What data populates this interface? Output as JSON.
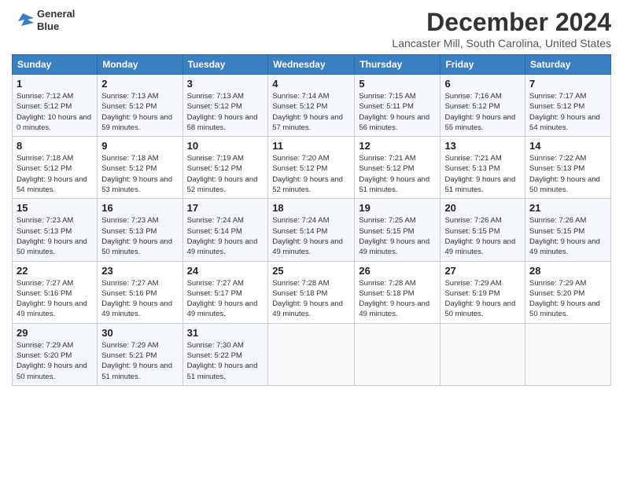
{
  "header": {
    "logo_line1": "General",
    "logo_line2": "Blue",
    "month": "December 2024",
    "location": "Lancaster Mill, South Carolina, United States"
  },
  "days_of_week": [
    "Sunday",
    "Monday",
    "Tuesday",
    "Wednesday",
    "Thursday",
    "Friday",
    "Saturday"
  ],
  "weeks": [
    [
      {
        "day": "1",
        "sunrise": "Sunrise: 7:12 AM",
        "sunset": "Sunset: 5:12 PM",
        "daylight": "Daylight: 10 hours and 0 minutes."
      },
      {
        "day": "2",
        "sunrise": "Sunrise: 7:13 AM",
        "sunset": "Sunset: 5:12 PM",
        "daylight": "Daylight: 9 hours and 59 minutes."
      },
      {
        "day": "3",
        "sunrise": "Sunrise: 7:13 AM",
        "sunset": "Sunset: 5:12 PM",
        "daylight": "Daylight: 9 hours and 58 minutes."
      },
      {
        "day": "4",
        "sunrise": "Sunrise: 7:14 AM",
        "sunset": "Sunset: 5:12 PM",
        "daylight": "Daylight: 9 hours and 57 minutes."
      },
      {
        "day": "5",
        "sunrise": "Sunrise: 7:15 AM",
        "sunset": "Sunset: 5:11 PM",
        "daylight": "Daylight: 9 hours and 56 minutes."
      },
      {
        "day": "6",
        "sunrise": "Sunrise: 7:16 AM",
        "sunset": "Sunset: 5:12 PM",
        "daylight": "Daylight: 9 hours and 55 minutes."
      },
      {
        "day": "7",
        "sunrise": "Sunrise: 7:17 AM",
        "sunset": "Sunset: 5:12 PM",
        "daylight": "Daylight: 9 hours and 54 minutes."
      }
    ],
    [
      {
        "day": "8",
        "sunrise": "Sunrise: 7:18 AM",
        "sunset": "Sunset: 5:12 PM",
        "daylight": "Daylight: 9 hours and 54 minutes."
      },
      {
        "day": "9",
        "sunrise": "Sunrise: 7:18 AM",
        "sunset": "Sunset: 5:12 PM",
        "daylight": "Daylight: 9 hours and 53 minutes."
      },
      {
        "day": "10",
        "sunrise": "Sunrise: 7:19 AM",
        "sunset": "Sunset: 5:12 PM",
        "daylight": "Daylight: 9 hours and 52 minutes."
      },
      {
        "day": "11",
        "sunrise": "Sunrise: 7:20 AM",
        "sunset": "Sunset: 5:12 PM",
        "daylight": "Daylight: 9 hours and 52 minutes."
      },
      {
        "day": "12",
        "sunrise": "Sunrise: 7:21 AM",
        "sunset": "Sunset: 5:12 PM",
        "daylight": "Daylight: 9 hours and 51 minutes."
      },
      {
        "day": "13",
        "sunrise": "Sunrise: 7:21 AM",
        "sunset": "Sunset: 5:13 PM",
        "daylight": "Daylight: 9 hours and 51 minutes."
      },
      {
        "day": "14",
        "sunrise": "Sunrise: 7:22 AM",
        "sunset": "Sunset: 5:13 PM",
        "daylight": "Daylight: 9 hours and 50 minutes."
      }
    ],
    [
      {
        "day": "15",
        "sunrise": "Sunrise: 7:23 AM",
        "sunset": "Sunset: 5:13 PM",
        "daylight": "Daylight: 9 hours and 50 minutes."
      },
      {
        "day": "16",
        "sunrise": "Sunrise: 7:23 AM",
        "sunset": "Sunset: 5:13 PM",
        "daylight": "Daylight: 9 hours and 50 minutes."
      },
      {
        "day": "17",
        "sunrise": "Sunrise: 7:24 AM",
        "sunset": "Sunset: 5:14 PM",
        "daylight": "Daylight: 9 hours and 49 minutes."
      },
      {
        "day": "18",
        "sunrise": "Sunrise: 7:24 AM",
        "sunset": "Sunset: 5:14 PM",
        "daylight": "Daylight: 9 hours and 49 minutes."
      },
      {
        "day": "19",
        "sunrise": "Sunrise: 7:25 AM",
        "sunset": "Sunset: 5:15 PM",
        "daylight": "Daylight: 9 hours and 49 minutes."
      },
      {
        "day": "20",
        "sunrise": "Sunrise: 7:26 AM",
        "sunset": "Sunset: 5:15 PM",
        "daylight": "Daylight: 9 hours and 49 minutes."
      },
      {
        "day": "21",
        "sunrise": "Sunrise: 7:26 AM",
        "sunset": "Sunset: 5:15 PM",
        "daylight": "Daylight: 9 hours and 49 minutes."
      }
    ],
    [
      {
        "day": "22",
        "sunrise": "Sunrise: 7:27 AM",
        "sunset": "Sunset: 5:16 PM",
        "daylight": "Daylight: 9 hours and 49 minutes."
      },
      {
        "day": "23",
        "sunrise": "Sunrise: 7:27 AM",
        "sunset": "Sunset: 5:16 PM",
        "daylight": "Daylight: 9 hours and 49 minutes."
      },
      {
        "day": "24",
        "sunrise": "Sunrise: 7:27 AM",
        "sunset": "Sunset: 5:17 PM",
        "daylight": "Daylight: 9 hours and 49 minutes."
      },
      {
        "day": "25",
        "sunrise": "Sunrise: 7:28 AM",
        "sunset": "Sunset: 5:18 PM",
        "daylight": "Daylight: 9 hours and 49 minutes."
      },
      {
        "day": "26",
        "sunrise": "Sunrise: 7:28 AM",
        "sunset": "Sunset: 5:18 PM",
        "daylight": "Daylight: 9 hours and 49 minutes."
      },
      {
        "day": "27",
        "sunrise": "Sunrise: 7:29 AM",
        "sunset": "Sunset: 5:19 PM",
        "daylight": "Daylight: 9 hours and 50 minutes."
      },
      {
        "day": "28",
        "sunrise": "Sunrise: 7:29 AM",
        "sunset": "Sunset: 5:20 PM",
        "daylight": "Daylight: 9 hours and 50 minutes."
      }
    ],
    [
      {
        "day": "29",
        "sunrise": "Sunrise: 7:29 AM",
        "sunset": "Sunset: 5:20 PM",
        "daylight": "Daylight: 9 hours and 50 minutes."
      },
      {
        "day": "30",
        "sunrise": "Sunrise: 7:29 AM",
        "sunset": "Sunset: 5:21 PM",
        "daylight": "Daylight: 9 hours and 51 minutes."
      },
      {
        "day": "31",
        "sunrise": "Sunrise: 7:30 AM",
        "sunset": "Sunset: 5:22 PM",
        "daylight": "Daylight: 9 hours and 51 minutes."
      },
      null,
      null,
      null,
      null
    ]
  ]
}
